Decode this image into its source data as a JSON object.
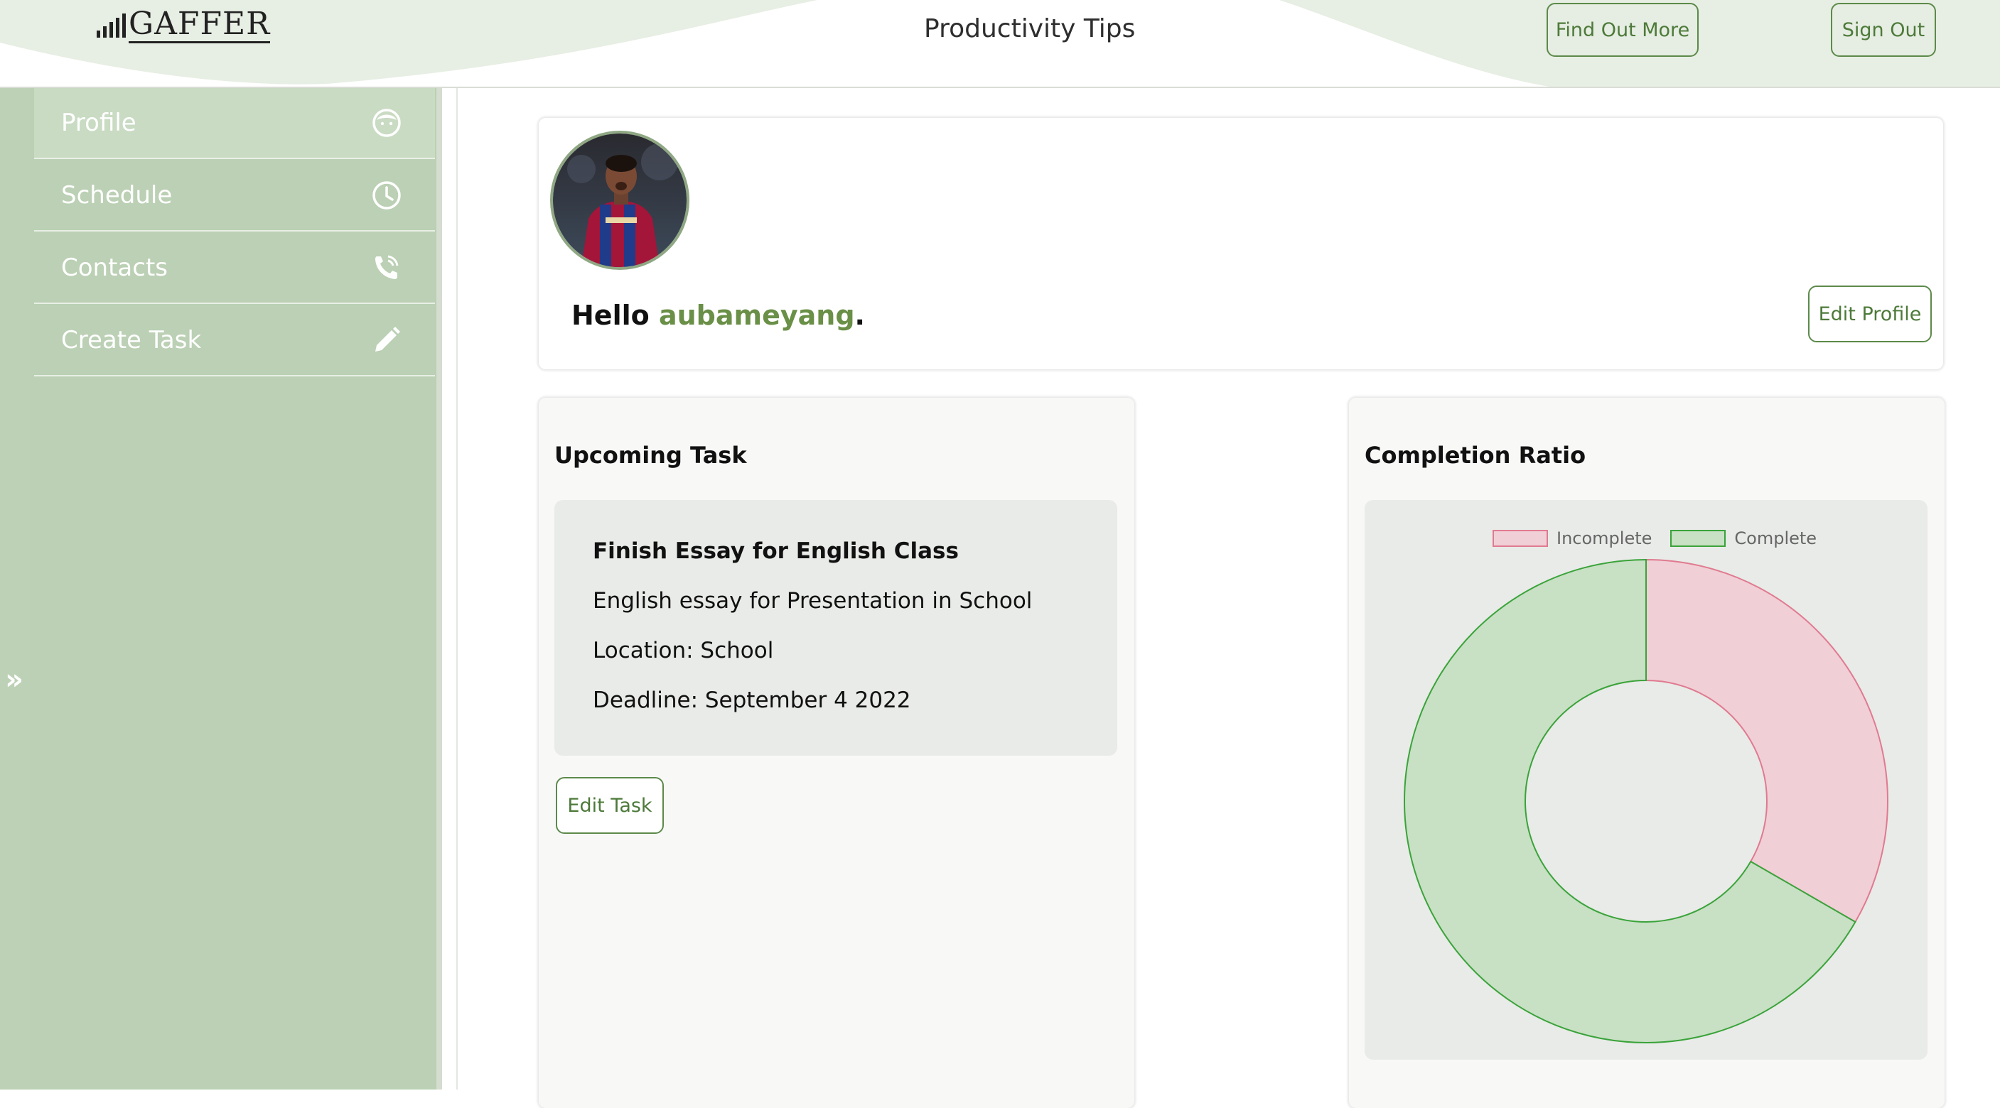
{
  "header": {
    "logo_text": "GAFFER",
    "title": "Productivity Tips",
    "find_out_more": "Find Out More",
    "sign_out": "Sign Out"
  },
  "sidebar": {
    "items": [
      {
        "label": "Profile",
        "icon": "face-icon"
      },
      {
        "label": "Schedule",
        "icon": "clock-icon"
      },
      {
        "label": "Contacts",
        "icon": "phone-icon"
      },
      {
        "label": "Create Task",
        "icon": "pencil-icon"
      }
    ],
    "expand_glyph": "»"
  },
  "profile": {
    "greeting": "Hello",
    "username": "aubameyang",
    "punct": ".",
    "edit_label": "Edit Profile"
  },
  "upcoming": {
    "title": "Upcoming Task",
    "task_name": "Finish Essay for English Class",
    "task_desc": "English essay for Presentation in School",
    "location": "Location: School",
    "deadline": "Deadline: September 4 2022",
    "edit_label": "Edit Task"
  },
  "ratio": {
    "title": "Completion Ratio"
  },
  "chart_data": {
    "type": "pie",
    "title": "Completion Ratio",
    "categories": [
      "Incomplete",
      "Complete"
    ],
    "values": [
      1,
      2
    ],
    "colors": {
      "Incomplete": "#f0cfd6",
      "Complete": "#c8e0c4"
    },
    "borders": {
      "Incomplete": "#e07a90",
      "Complete": "#3aa33a"
    },
    "legend": "top"
  }
}
